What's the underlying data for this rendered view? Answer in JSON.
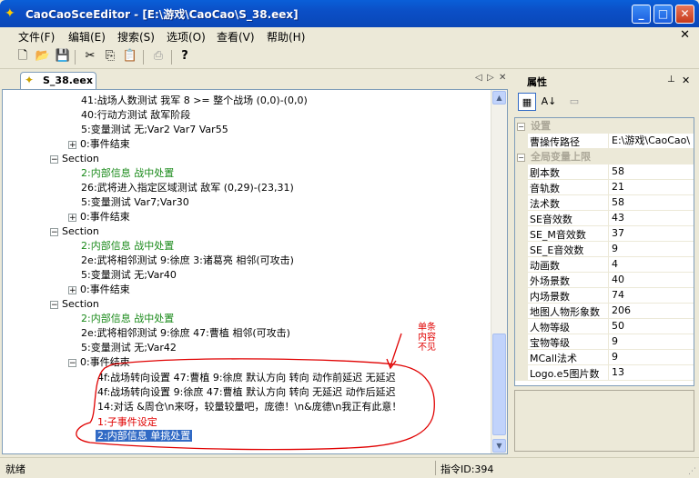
{
  "window": {
    "title": "CaoCaoSceEditor - [E:\\游戏\\CaoCao\\S_38.eex]"
  },
  "menu": [
    "文件(F)",
    "编辑(E)",
    "搜索(S)",
    "选项(O)",
    "查看(V)",
    "帮助(H)"
  ],
  "tab": {
    "label": "S_38.eex"
  },
  "tree": [
    {
      "text": "41:战场人数测试 我军 8 >= 整个战场 (0,0)-(0,0)",
      "color": "normal"
    },
    {
      "text": "40:行动方测试 敌军阶段",
      "color": "normal"
    },
    {
      "text": "5:变量测试 无;Var2 Var7 Var55",
      "color": "normal"
    },
    {
      "text": "0:事件结束",
      "color": "normal"
    },
    {
      "text": "Section",
      "color": "normal"
    },
    {
      "text": "2:内部信息 战中处置",
      "color": "green"
    },
    {
      "text": "26:武将进入指定区域测试 敌军 (0,29)-(23,31)",
      "color": "normal"
    },
    {
      "text": "5:变量测试 Var7;Var30",
      "color": "normal"
    },
    {
      "text": "0:事件结束",
      "color": "normal"
    },
    {
      "text": "Section",
      "color": "normal"
    },
    {
      "text": "2:内部信息 战中处置",
      "color": "green"
    },
    {
      "text": "2e:武将相邻测试 9:徐庶 3:诸葛亮 相邻(可攻击)",
      "color": "normal"
    },
    {
      "text": "5:变量测试 无;Var40",
      "color": "normal"
    },
    {
      "text": "0:事件结束",
      "color": "normal"
    },
    {
      "text": "Section",
      "color": "normal"
    },
    {
      "text": "2:内部信息 战中处置",
      "color": "green"
    },
    {
      "text": "2e:武将相邻测试 9:徐庶 47:曹植 相邻(可攻击)",
      "color": "normal"
    },
    {
      "text": "5:变量测试 无;Var42",
      "color": "normal"
    },
    {
      "text": "0:事件结束",
      "color": "normal"
    },
    {
      "text": "4f:战场转向设置 47:曹植 9:徐庶 默认方向 转向 动作前延迟 无延迟",
      "color": "normal"
    },
    {
      "text": "4f:战场转向设置 9:徐庶 47:曹植 默认方向 转向 无延迟 动作后延迟",
      "color": "normal"
    },
    {
      "text": "14:对话 &周仓\\n来呀，较量较量吧，庞德！\\n&庞德\\n我正有此意！",
      "color": "normal"
    },
    {
      "text": "1:子事件设定",
      "color": "red"
    },
    {
      "text": "2:内部信息 单挑处置",
      "color": "selected"
    }
  ],
  "annotation": [
    "单条",
    "内容",
    "不见"
  ],
  "properties": {
    "title": "属性",
    "categories": [
      {
        "name": "设置",
        "rows": [
          {
            "name": "曹操传路径",
            "value": "E:\\游戏\\CaoCao\\"
          }
        ]
      },
      {
        "name": "全局变量上限",
        "rows": [
          {
            "name": "剧本数",
            "value": "58"
          },
          {
            "name": "音轨数",
            "value": "21"
          },
          {
            "name": "法术数",
            "value": "58"
          },
          {
            "name": "SE音效数",
            "value": "43"
          },
          {
            "name": "SE_M音效数",
            "value": "37"
          },
          {
            "name": "SE_E音效数",
            "value": "9"
          },
          {
            "name": "动画数",
            "value": "4"
          },
          {
            "name": "外场景数",
            "value": "40"
          },
          {
            "name": "内场景数",
            "value": "74"
          },
          {
            "name": "地图人物形象数",
            "value": "206"
          },
          {
            "name": "人物等级",
            "value": "50"
          },
          {
            "name": "宝物等级",
            "value": "9"
          },
          {
            "name": "MCall法术",
            "value": "9"
          },
          {
            "name": "Logo.e5图片数",
            "value": "13"
          }
        ]
      }
    ]
  },
  "status": {
    "left": "就绪",
    "right": "指令ID:394"
  },
  "colors": {
    "titlebar": "#0a5fd8",
    "selection": "#316ac5",
    "green": "#1a8a1a",
    "red": "#e00000"
  }
}
